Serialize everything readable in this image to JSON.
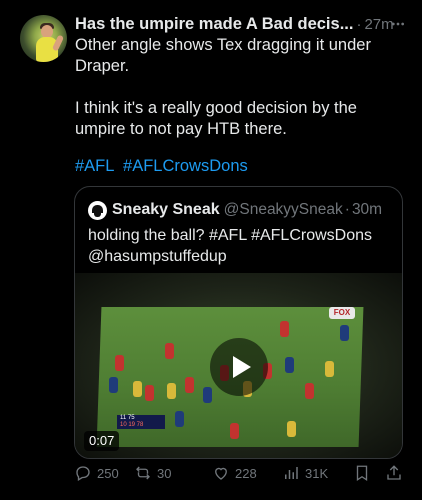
{
  "post": {
    "author_name": "Has the umpire made A Bad decis...",
    "time": "27m",
    "text_line1": "Other angle shows Tex dragging it under Draper.",
    "text_line2": "I think it's a really good decision by the umpire to not pay HTB there.",
    "hashtags": [
      "#AFL",
      "#AFLCrowsDons"
    ],
    "link_color": "#1d9bf0"
  },
  "quoted": {
    "name": "Sneaky Sneak",
    "handle": "@SneakyySneak",
    "time": "30m",
    "text": "holding the ball? #AFL #AFLCrowsDons @hasumpstuffedup",
    "video": {
      "duration": "0:07",
      "sponsor": "FOX",
      "score_row1": "11   75",
      "score_row2": "10  19  78"
    }
  },
  "actions": {
    "replies": "250",
    "reposts": "30",
    "likes": "228",
    "views": "31K"
  },
  "icons": [
    "more-icon",
    "reply-icon",
    "repost-icon",
    "like-icon",
    "views-icon",
    "bookmark-icon",
    "share-icon",
    "play-icon"
  ]
}
